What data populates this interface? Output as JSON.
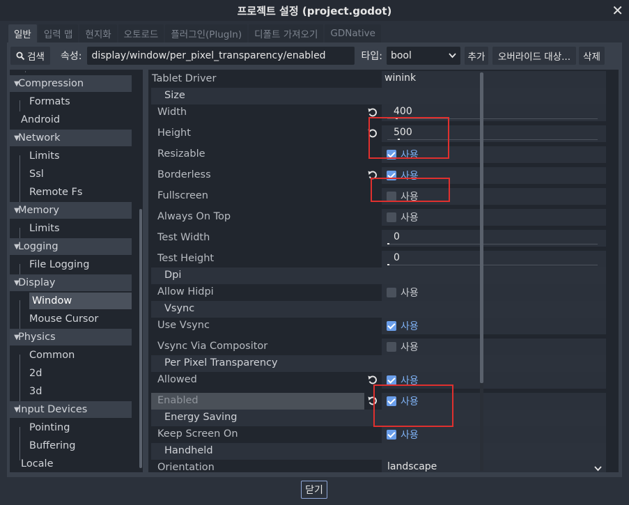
{
  "window": {
    "title": "프로젝트 설정 (project.godot)",
    "close_glyph": "✕"
  },
  "tabs": [
    "일반",
    "입력 맵",
    "현지화",
    "오토로드",
    "플러그인(PlugIn)",
    "디폴트 가져오기",
    "GDNative"
  ],
  "toolbar": {
    "search_label": "검색",
    "property_label": "속성:",
    "property_value": "display/window/per_pixel_transparency/enabled",
    "type_label": "타입:",
    "type_value": "bool",
    "add_label": "추가",
    "override_label": "오버라이드 대상...",
    "delete_label": "삭제"
  },
  "tree": [
    {
      "label": "Compression",
      "kind": "cat"
    },
    {
      "label": "Formats",
      "kind": "leaf"
    },
    {
      "label": "Android",
      "kind": "plain"
    },
    {
      "label": "Network",
      "kind": "cat"
    },
    {
      "label": "Limits",
      "kind": "leaf"
    },
    {
      "label": "Ssl",
      "kind": "leaf"
    },
    {
      "label": "Remote Fs",
      "kind": "leaf"
    },
    {
      "label": "Memory",
      "kind": "cat"
    },
    {
      "label": "Limits",
      "kind": "leaf"
    },
    {
      "label": "Logging",
      "kind": "cat"
    },
    {
      "label": "File Logging",
      "kind": "leaf"
    },
    {
      "label": "Display",
      "kind": "cat"
    },
    {
      "label": "Window",
      "kind": "sel"
    },
    {
      "label": "Mouse Cursor",
      "kind": "leaf"
    },
    {
      "label": "Physics",
      "kind": "cat"
    },
    {
      "label": "Common",
      "kind": "leaf"
    },
    {
      "label": "2d",
      "kind": "leaf"
    },
    {
      "label": "3d",
      "kind": "leaf"
    },
    {
      "label": "Input Devices",
      "kind": "cat"
    },
    {
      "label": "Pointing",
      "kind": "leaf"
    },
    {
      "label": "Buffering",
      "kind": "leaf"
    },
    {
      "label": "Locale",
      "kind": "plain"
    }
  ],
  "properties": {
    "tablet_driver": {
      "name": "Tablet Driver",
      "value": "winink"
    },
    "size_section": "Size",
    "width": {
      "name": "Width",
      "value": "400",
      "fill": 0.04
    },
    "height": {
      "name": "Height",
      "value": "500",
      "fill": 0.05
    },
    "resizable": {
      "name": "Resizable",
      "text": "사용"
    },
    "borderless": {
      "name": "Borderless",
      "text": "사용"
    },
    "fullscreen": {
      "name": "Fullscreen",
      "text": "사용"
    },
    "always_on_top": {
      "name": "Always On Top",
      "text": "사용"
    },
    "test_width": {
      "name": "Test Width",
      "value": "0"
    },
    "test_height": {
      "name": "Test Height",
      "value": "0"
    },
    "dpi_section": "Dpi",
    "allow_hidpi": {
      "name": "Allow Hidpi",
      "text": "사용"
    },
    "vsync_section": "Vsync",
    "use_vsync": {
      "name": "Use Vsync",
      "text": "사용"
    },
    "vsync_via_compositor": {
      "name": "Vsync Via Compositor",
      "text": "사용"
    },
    "ppt_section": "Per Pixel Transparency",
    "allowed": {
      "name": "Allowed",
      "text": "사용"
    },
    "enabled": {
      "name": "Enabled",
      "text": "사용"
    },
    "energy_section": "Energy Saving",
    "keep_screen_on": {
      "name": "Keep Screen On",
      "text": "사용"
    },
    "handheld_section": "Handheld",
    "orientation": {
      "name": "Orientation",
      "value": "landscape"
    }
  },
  "footer": {
    "close_label": "닫기"
  },
  "colors": {
    "accent": "#6a9eea",
    "highlight_box": "#e0302e"
  }
}
